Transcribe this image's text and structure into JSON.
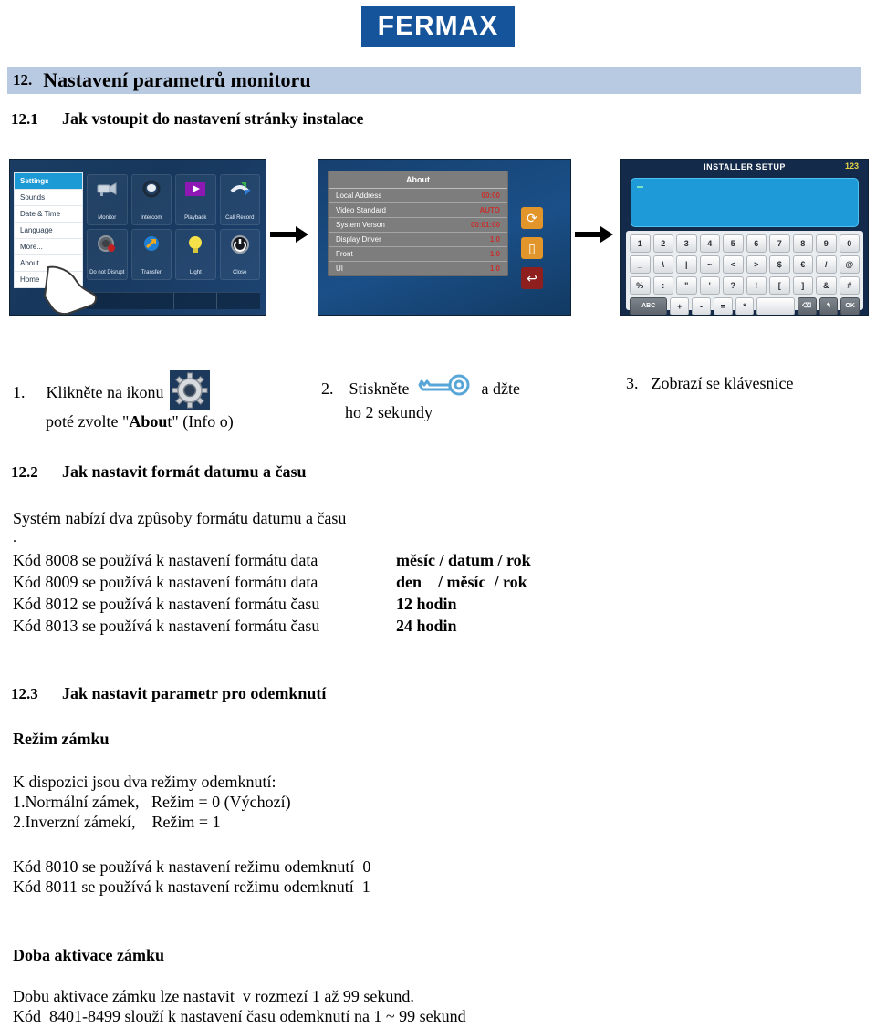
{
  "brand": {
    "name": "FERMAX",
    "color": "#15539b"
  },
  "section": {
    "number": "12.",
    "title": "Nastavení parametrů monitoru",
    "band_color": "#b8c9e2"
  },
  "sub1": {
    "number": "12.1",
    "title": "Jak vstoupit do nastavení stránky instalace"
  },
  "figures": {
    "settings_screen": {
      "menu": [
        {
          "label": "Settings",
          "active": true
        },
        {
          "label": "Sounds",
          "active": false
        },
        {
          "label": "Date & Time",
          "active": false
        },
        {
          "label": "Language",
          "active": false
        },
        {
          "label": "More...",
          "active": false
        },
        {
          "label": "About",
          "active": false
        },
        {
          "label": "Home",
          "active": false
        }
      ],
      "icons": [
        {
          "label": "Monitor",
          "glyph": "📹",
          "icon_name": "camera-icon"
        },
        {
          "label": "Intercom",
          "glyph": "☎",
          "icon_name": "intercom-icon"
        },
        {
          "label": "Playback",
          "glyph": "▶",
          "icon_name": "playback-icon"
        },
        {
          "label": "Call Record",
          "glyph": "📞",
          "icon_name": "call-record-icon"
        },
        {
          "label": "Do not Disrupt",
          "glyph": "🔕",
          "icon_name": "do-not-disturb-icon"
        },
        {
          "label": "Transfer",
          "glyph": "↗",
          "icon_name": "transfer-icon"
        },
        {
          "label": "Light",
          "glyph": "💡",
          "icon_name": "light-icon"
        },
        {
          "label": "Close",
          "glyph": "⏻",
          "icon_name": "close-power-icon"
        }
      ]
    },
    "about_screen": {
      "title": "About",
      "rows": [
        {
          "key": "Local Address",
          "value": "00:00"
        },
        {
          "key": "Video Standard",
          "value": "AUTO"
        },
        {
          "key": "System Verson",
          "value": "00:01:00"
        },
        {
          "key": "Display Driver",
          "value": "1.0"
        },
        {
          "key": "Front",
          "value": "1.0"
        },
        {
          "key": "UI",
          "value": "1.0"
        }
      ],
      "buttons": [
        {
          "name": "refresh",
          "glyph": "⟳"
        },
        {
          "name": "page",
          "glyph": "▯"
        },
        {
          "name": "back",
          "glyph": "↩"
        }
      ]
    },
    "keyboard_screen": {
      "title": "INSTALLER SETUP",
      "mode": "123",
      "value": "",
      "rows": [
        [
          "1",
          "2",
          "3",
          "4",
          "5",
          "6",
          "7",
          "8",
          "9",
          "0"
        ],
        [
          "_",
          "\\",
          "|",
          "~",
          "<",
          ">",
          "$",
          "€",
          "/",
          "@"
        ],
        [
          "%",
          ":",
          "\"",
          "'",
          "?",
          "!",
          "[",
          "]",
          "&",
          "#"
        ]
      ],
      "bottom_row": [
        {
          "label": "ABC",
          "type": "dark"
        },
        {
          "label": "+",
          "type": "light"
        },
        {
          "label": "-",
          "type": "light"
        },
        {
          "label": "=",
          "type": "light"
        },
        {
          "label": "*",
          "type": "light"
        },
        {
          "label": "",
          "type": "space"
        },
        {
          "label": "⌫",
          "type": "dark"
        },
        {
          "label": "↰",
          "type": "dark"
        },
        {
          "label": "OK",
          "type": "dark"
        }
      ]
    }
  },
  "steps": [
    {
      "number": "1.",
      "line1_pre": "Klikněte na ikonu ",
      "line2_pre": "poté zvolte \"",
      "line2_bold": "Abou",
      "line2_post": "t\" (Info o)"
    },
    {
      "number": "2.",
      "line1_pre": "Stiskněte ",
      "line1_post": " a džte",
      "line2": "ho 2 sekundy"
    },
    {
      "number": "3.",
      "line1": "Zobrazí se klávesnice"
    }
  ],
  "sub2": {
    "number": "12.2",
    "title": "Jak nastavit formát datumu a času",
    "intro": "Systém nabízí dva způsoby formátu datumu a času",
    "dot": ".",
    "rows": [
      {
        "left": "Kód 8008 se používá k nastavení formátu data",
        "right": "měsíc / datum / rok"
      },
      {
        "left": "Kód 8009 se používá k nastavení formátu data",
        "right": "den    / měsíc  / rok"
      },
      {
        "left": "Kód 8012 se používá k nastavení formátu času",
        "right": "12 hodin"
      },
      {
        "left": "Kód 8013 se používá k nastavení formátu času",
        "right": "24 hodin"
      }
    ]
  },
  "sub3": {
    "number": "12.3",
    "title": "Jak nastavit parametr pro odemknutí",
    "lock_mode_heading": "Režim zámku",
    "lines": [
      "K dispozici jsou dva režimy odemknutí:",
      "1.Normální zámek,   Režim = 0 (Výchozí)",
      "2.Inverzní zámekí,    Režim = 1"
    ],
    "codes": [
      "Kód 8010 se používá k nastavení režimu odemknutí  0",
      "Kód 8011 se používá k nastavení režimu odemknutí  1"
    ],
    "activation_heading": "Doba aktivace  zámku",
    "activation_lines": [
      "Dobu aktivace zámku lze nastavit  v rozmezí 1 až 99 sekund.",
      "Kód  8401-8499 slouží k nastavení času odemknutí na 1 ~ 99 sekund"
    ]
  }
}
